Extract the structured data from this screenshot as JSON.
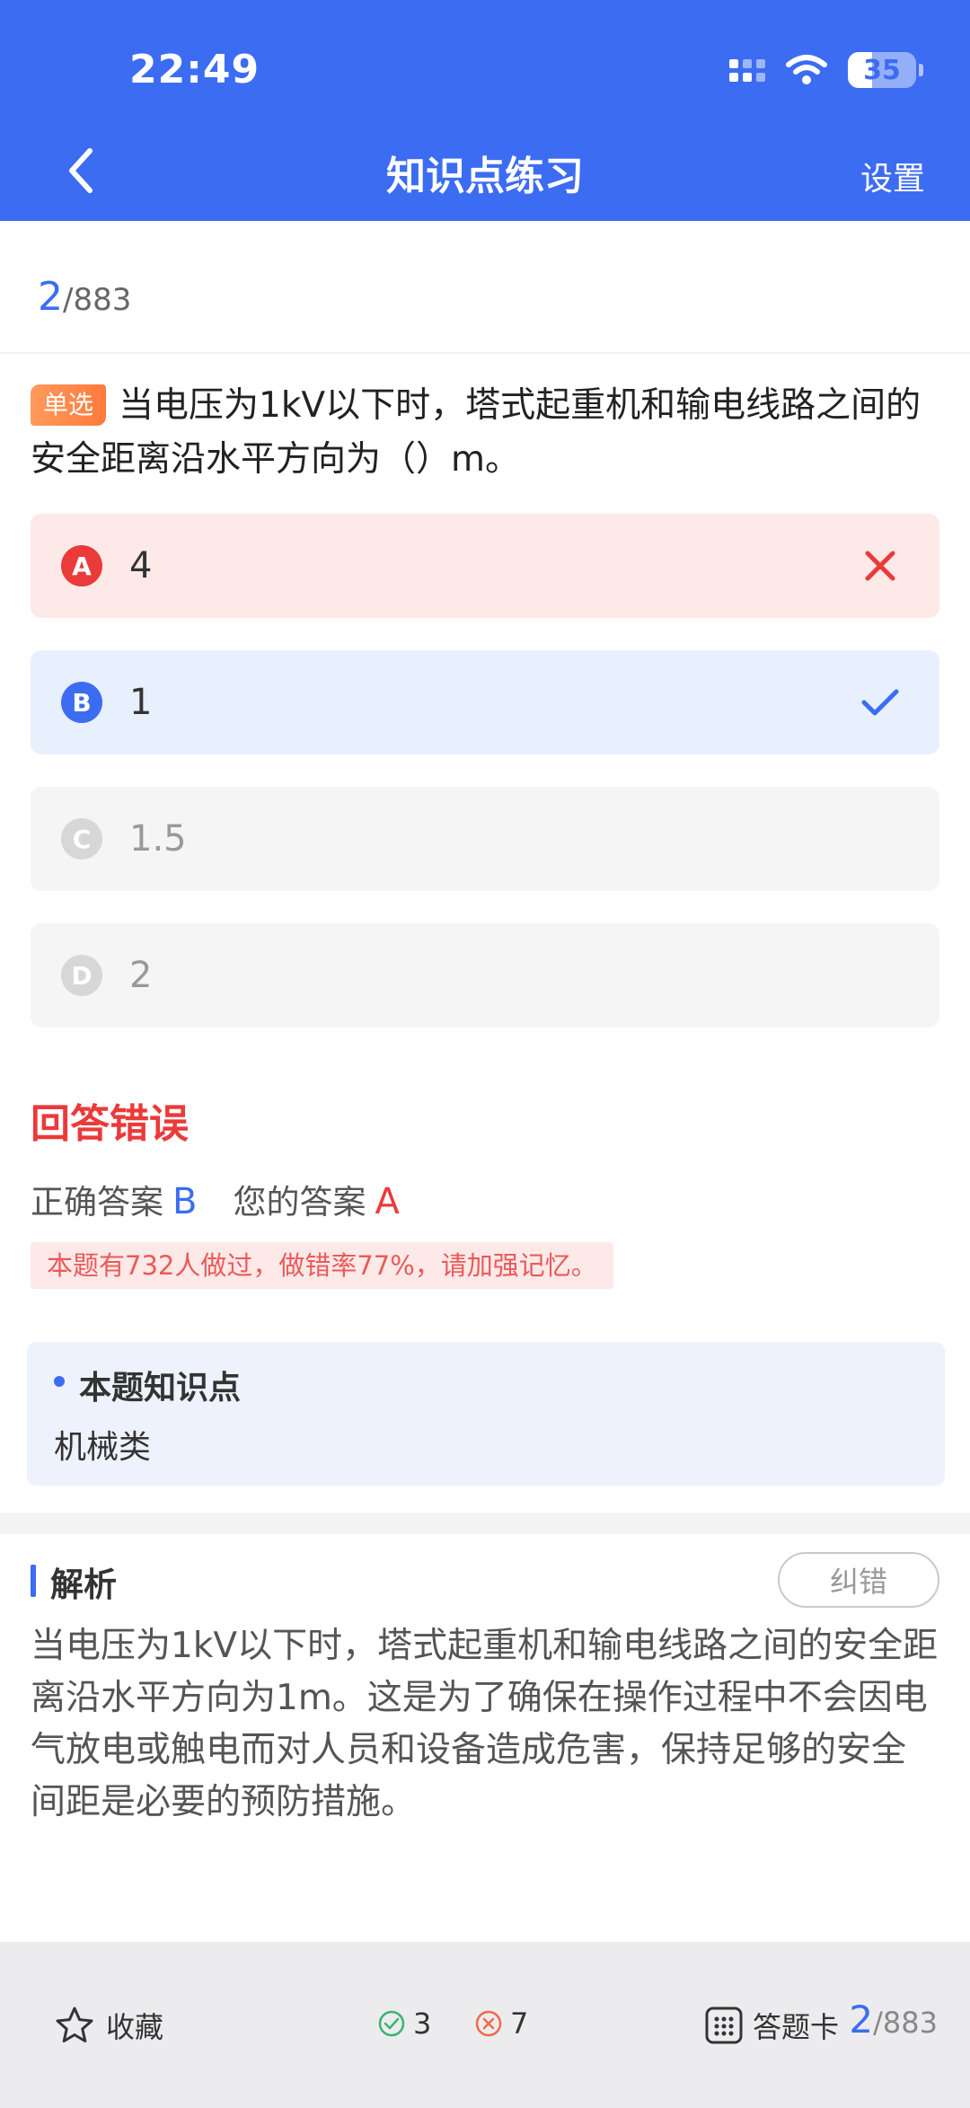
{
  "status_bar": {
    "time": "22:49",
    "battery": "35",
    "battery_level": 0.35
  },
  "nav": {
    "title": "知识点练习",
    "settings_label": "设置"
  },
  "progress": {
    "current": "2",
    "total": "/883"
  },
  "question": {
    "type": "单选",
    "text": "当电压为1kV以下时，塔式起重机和输电线路之间的安全距离沿水平方向为（）m。",
    "options": [
      {
        "letter": "A",
        "value": "4",
        "state": "wrong"
      },
      {
        "letter": "B",
        "value": "1",
        "state": "correct"
      },
      {
        "letter": "C",
        "value": "1.5",
        "state": "normal"
      },
      {
        "letter": "D",
        "value": "2",
        "state": "normal"
      }
    ]
  },
  "result": {
    "title": "回答错误",
    "correct_label": "正确答案",
    "correct_value": "B",
    "your_label": "您的答案",
    "your_value": "A",
    "stat": "本题有732人做过，做错率77%，请加强记忆。"
  },
  "knowledge": {
    "title": "本题知识点",
    "value": "机械类"
  },
  "analysis": {
    "title": "解析",
    "report_button": "纠错",
    "text": "当电压为1kV以下时，塔式起重机和输电线路之间的安全距离沿水平方向为1m。这是为了确保在操作过程中不会因电气放电或触电而对人员和设备造成危害，保持足够的安全间距是必要的预防措施。"
  },
  "bottom_bar": {
    "favorite_label": "收藏",
    "correct_count": "3",
    "wrong_count": "7",
    "answer_sheet_label": "答题卡",
    "progress_current": "2",
    "progress_total": "/883"
  },
  "colors": {
    "primary": "#3c6cf2",
    "error": "#ea3a3a",
    "tag": "#ff8a4c"
  },
  "icons": [
    "back-chevron-icon",
    "wifi-icon",
    "signal-icon",
    "battery-icon",
    "cross-icon",
    "check-icon",
    "star-icon",
    "check-circle-icon",
    "cross-circle-icon",
    "grid-icon"
  ]
}
